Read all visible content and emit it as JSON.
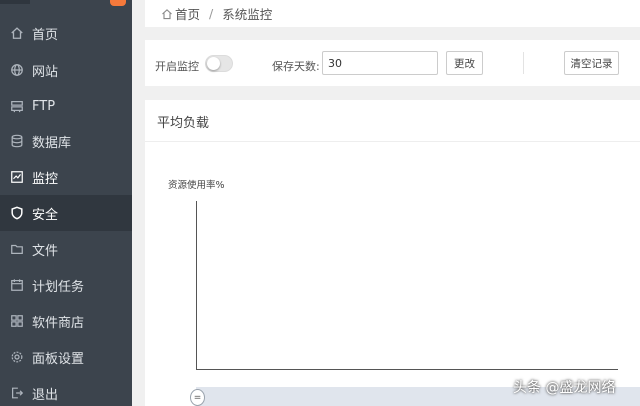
{
  "sidebar": {
    "items": [
      {
        "label": "首页",
        "icon": "home-icon"
      },
      {
        "label": "网站",
        "icon": "globe-icon"
      },
      {
        "label": "FTP",
        "icon": "ftp-icon"
      },
      {
        "label": "数据库",
        "icon": "database-icon"
      },
      {
        "label": "监控",
        "icon": "monitor-icon"
      },
      {
        "label": "安全",
        "icon": "shield-icon"
      },
      {
        "label": "文件",
        "icon": "folder-icon"
      },
      {
        "label": "计划任务",
        "icon": "calendar-icon"
      },
      {
        "label": "软件商店",
        "icon": "apps-icon"
      },
      {
        "label": "面板设置",
        "icon": "gear-icon"
      },
      {
        "label": "退出",
        "icon": "logout-icon"
      }
    ],
    "colors": {
      "background": "#3c444d",
      "active": "#30373f",
      "badge": "#f5793b"
    }
  },
  "breadcrumb": {
    "home": "首页",
    "separator": "/",
    "current": "系统监控"
  },
  "controls": {
    "monitor_label": "开启监控",
    "monitor_enabled": false,
    "days_label": "保存天数:",
    "days_value": "30",
    "change_button": "更改",
    "clear_button": "清空记录"
  },
  "panel": {
    "title": "平均负载",
    "ylabel": "资源使用率%"
  },
  "watermark": "头条 @盛龙网络"
}
